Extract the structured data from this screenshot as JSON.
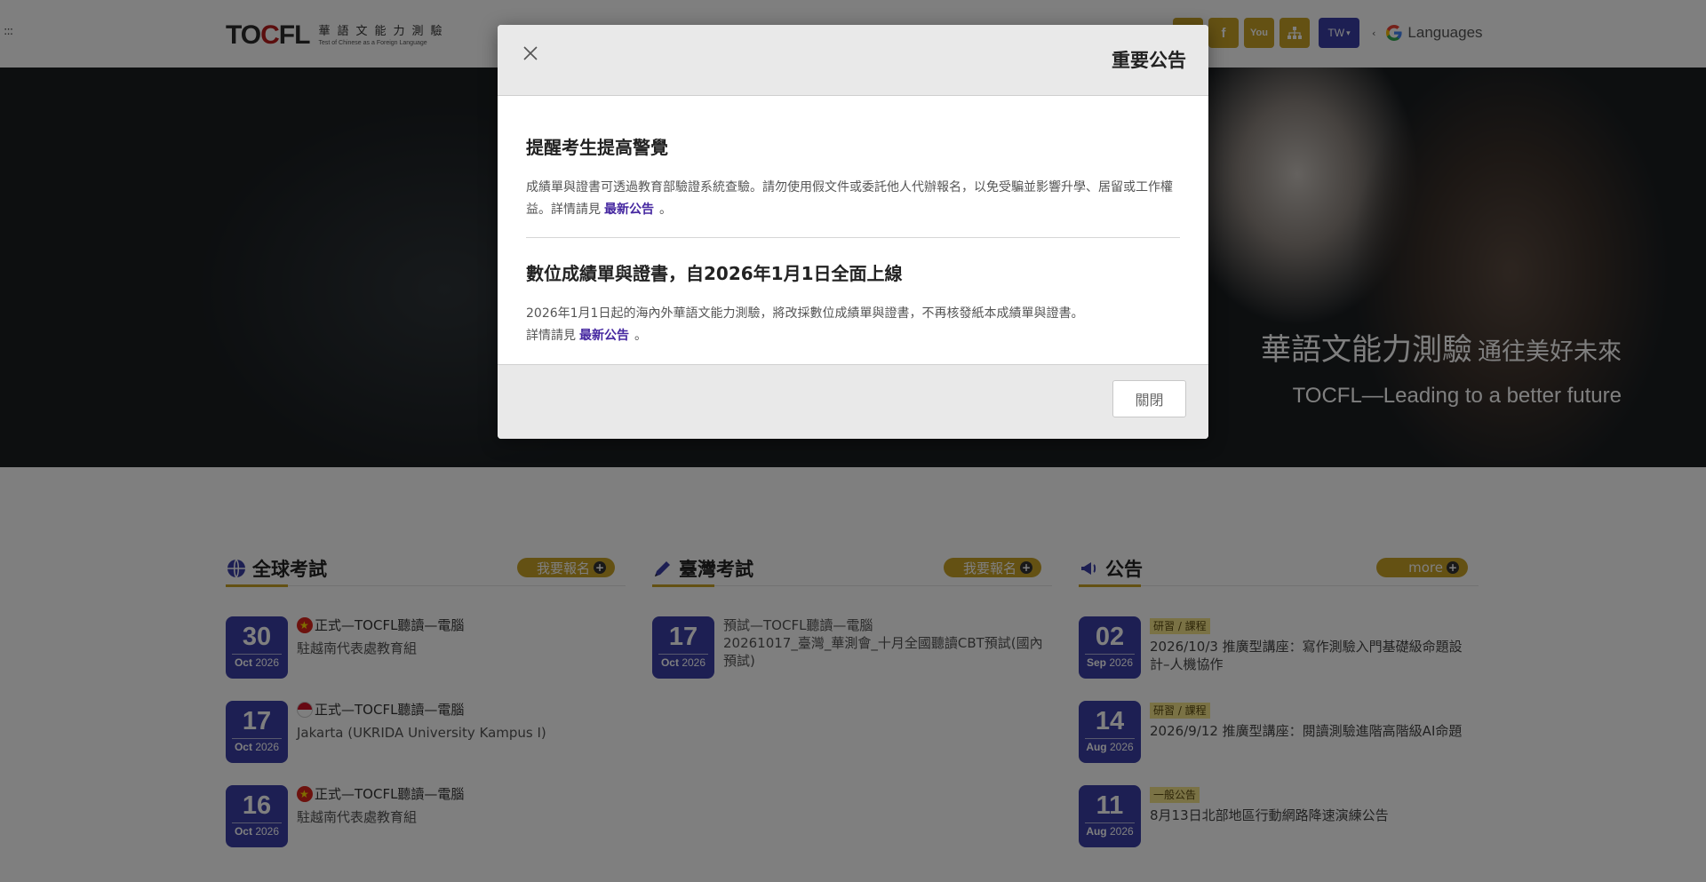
{
  "header": {
    "menu_glyph": ":::",
    "logo_word_a": "TO",
    "logo_word_o": "C",
    "logo_word_b": "FL",
    "logo_cn": "華語文能力測驗",
    "logo_en": "Test of Chinese as a Foreign Language",
    "social": {
      "facebook": "f",
      "youtube": "You",
      "sitemap": "⌂"
    },
    "lang_select": "TW",
    "lang_caret": "‹",
    "google_languages": "Languages"
  },
  "hero": {
    "title_main": "華語文能力測驗",
    "title_sub": "通往美好未來",
    "title_en": "TOCFL—Leading to a better future"
  },
  "sections": {
    "global": {
      "title": "全球考試",
      "button": "我要報名",
      "events": [
        {
          "day": "30",
          "month": "Oct",
          "year": "2026",
          "title": "正式—TOCFL聽讀—電腦",
          "venue": "駐越南代表處教育組",
          "flag": "vn"
        },
        {
          "day": "17",
          "month": "Oct",
          "year": "2026",
          "title": "正式—TOCFL聽讀—電腦",
          "venue": "Jakarta (UKRIDA University Kampus I)",
          "flag": "id"
        },
        {
          "day": "16",
          "month": "Oct",
          "year": "2026",
          "title": "正式—TOCFL聽讀—電腦",
          "venue": "駐越南代表處教育組",
          "flag": "vn"
        }
      ]
    },
    "taiwan": {
      "title": "臺灣考試",
      "button": "我要報名",
      "events": [
        {
          "day": "17",
          "month": "Oct",
          "year": "2026",
          "title": "預試—TOCFL聽讀—電腦",
          "venue": "20261017_臺灣_華測會_十月全國聽讀CBT預試(國內預試)"
        }
      ]
    },
    "news": {
      "title": "公告",
      "button": "more",
      "items": [
        {
          "day": "02",
          "month": "Sep",
          "year": "2026",
          "tag": "研習 / 課程",
          "title": "2026/10/3 推廣型講座：寫作測驗入門基礎級命題設計–人機協作"
        },
        {
          "day": "14",
          "month": "Aug",
          "year": "2026",
          "tag": "研習 / 課程",
          "title": "2026/9/12 推廣型講座：閱讀測驗進階高階級AI命題"
        },
        {
          "day": "11",
          "month": "Aug",
          "year": "2026",
          "tag": "一般公告",
          "title": "8月13日北部地區行動網路降速演練公告"
        }
      ]
    }
  },
  "modal": {
    "title": "重要公告",
    "notice1": {
      "heading": "提醒考生提高警覺",
      "text": "成績單與證書可透過教育部驗證系統查驗。請勿使用假文件或委託他人代辦報名，以免受騙並影響升學、居留或工作權益。詳情請見",
      "link": "最新公告",
      "end": "。"
    },
    "notice2": {
      "heading": "數位成績單與證書，自2026年1月1日全面上線",
      "text1": "2026年1月1日起的海內外華語文能力測驗，將改採數位成績單與證書，不再核發紙本成績單與證書。",
      "text2": "詳情請見",
      "link": "最新公告",
      "end": "。"
    },
    "close_button": "關閉"
  },
  "colors": {
    "accent_gold": "#c9a227",
    "date_purple": "#3b3fa6",
    "link_purple": "#4527a0"
  }
}
